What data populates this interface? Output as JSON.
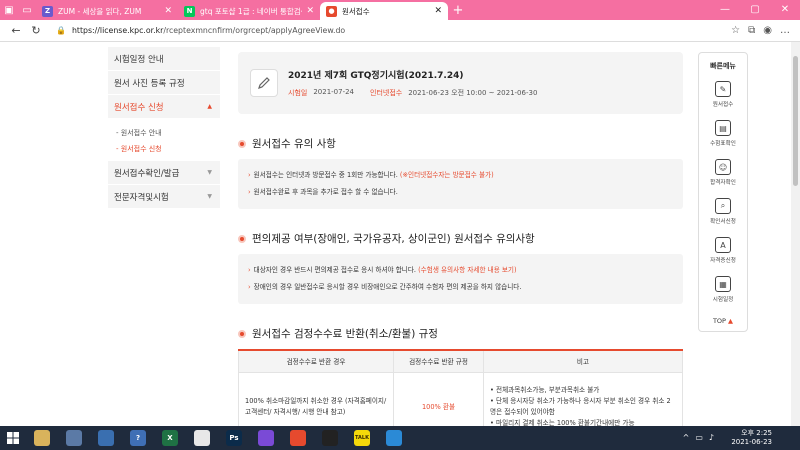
{
  "browser": {
    "tabs": [
      {
        "label": "ZUM - 세상을 읽다, ZUM",
        "fav": "Z",
        "color": "#6a5acd",
        "active": false
      },
      {
        "label": "gtq 포토샵 1급 : 네이버 통합검색",
        "fav": "N",
        "color": "#03c75a",
        "active": false
      },
      {
        "label": "원서접수",
        "fav": "●",
        "color": "#e64a2e",
        "active": true
      }
    ],
    "url_host": "https://license.kpc.or.kr",
    "url_path": "/rceptexmncnfirm/orgrcept/applyAgreeView.do"
  },
  "sidebar": {
    "items": [
      {
        "label": "시험일정 안내"
      },
      {
        "label": "원서 사진 등록 규정"
      },
      {
        "label": "원서접수 신청",
        "active": true
      }
    ],
    "subitems": [
      {
        "label": "- 원서접수 안내",
        "on": false
      },
      {
        "label": "- 원서접수 신청",
        "on": true
      }
    ],
    "items_after": [
      {
        "label": "원서접수확인/발급"
      },
      {
        "label": "전문자격및시험"
      }
    ]
  },
  "exam": {
    "title": "2021년 제7회 GTQ정기시험(2021.7.24)",
    "date_label": "시험일",
    "date": "2021-07-24",
    "reg_label": "인터넷접수",
    "reg_period": "2021-06-23 오전 10:00 ~ 2021-06-30"
  },
  "section1": {
    "title": "원서접수 유의 사항",
    "line1": "원서접수는 인터넷과 방문접수 중 1회만 가능합니다.",
    "line1_red": "(※인터넷접수자는 방문접수 불가)",
    "line2": "원서접수완료 후 과목을 추가로 접수 할 수 없습니다."
  },
  "section2": {
    "title": "편의제공 여부(장애인, 국가유공자, 상이군인) 원서접수 유의사항",
    "line1": "대상자인 경우 반드시 편의제공 접수로 응시 하셔야 합니다.",
    "line1_red": "(수험생 유의사항 자세한 내용 보기)",
    "line2": "장애인의 경우 일반접수로 응시할 경우 비장애인으로 간주하여 수험자 편의 제공을 하지 않습니다."
  },
  "section3": {
    "title": "원서접수 검정수수료 반환(취소/환불) 규정",
    "headers": [
      "검정수수료 반환 경우",
      "검정수수료 반환 규정",
      "비고"
    ],
    "row1_case": "100% 취소마감일까지 취소한 경우 (자격홈페이지/ 고객센터/ 자격시행/ 시행 안내 참고)",
    "row1_rule": "100% 환불",
    "row1_notes": [
      "전체과목취소가능, 부분과목취소 불가",
      "단체 응시자당 취소가 가능하나 응시자 부분 취소인 경우 취소 2명은 접수되어 있어야함",
      "마일리지 결제 취소는 100% 환불기간내에만 가능"
    ]
  },
  "quickmenu": {
    "title": "빠른메뉴",
    "items": [
      {
        "label": "원서접수",
        "icon": "✎"
      },
      {
        "label": "수험표확인",
        "icon": "▤"
      },
      {
        "label": "합격자확인",
        "icon": "☺"
      },
      {
        "label": "확인서신청",
        "icon": "⌕"
      },
      {
        "label": "자격증신청",
        "icon": "A"
      },
      {
        "label": "시험일정",
        "icon": "▦"
      }
    ],
    "top_label": "TOP"
  },
  "taskbar": {
    "time": "오후 2:25",
    "date": "2021-06-23",
    "apps": [
      {
        "label": "",
        "color": "#d9b35c"
      },
      {
        "label": "",
        "color": "#5b7aa6"
      },
      {
        "label": "",
        "color": "#3a6fb0"
      },
      {
        "label": "?",
        "color": "#3f6fb5"
      },
      {
        "label": "X",
        "color": "#1f7244"
      },
      {
        "label": "",
        "color": "#e8e8e8"
      },
      {
        "label": "Ps",
        "color": "#0b2b4a"
      },
      {
        "label": "",
        "color": "#7a4ad6"
      },
      {
        "label": "",
        "color": "#e64a2e"
      },
      {
        "label": "",
        "color": "#222222"
      },
      {
        "label": "TALK",
        "color": "#f5d90a"
      },
      {
        "label": "",
        "color": "#2b8ad6"
      }
    ]
  }
}
